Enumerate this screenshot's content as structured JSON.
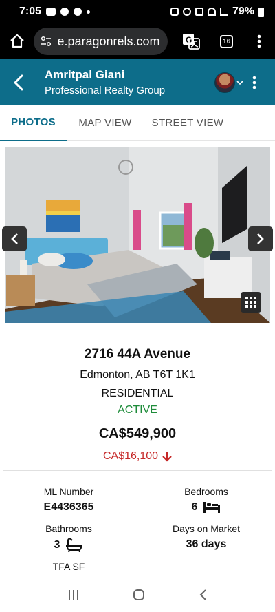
{
  "status_bar": {
    "time": "7:05",
    "battery": "79%"
  },
  "browser": {
    "url": "e.paragonrels.com",
    "tab_count": "16"
  },
  "header": {
    "agent_name": "Amritpal Giani",
    "company": "Professional Realty Group"
  },
  "tabs": [
    {
      "label": "PHOTOS",
      "active": true
    },
    {
      "label": "MAP VIEW",
      "active": false
    },
    {
      "label": "STREET VIEW",
      "active": false
    }
  ],
  "listing": {
    "address": "2716 44A Avenue",
    "city": "Edmonton, AB T6T 1K1",
    "type": "RESIDENTIAL",
    "status": "ACTIVE",
    "price": "CA$549,900",
    "price_change": "CA$16,100",
    "price_change_direction": "down"
  },
  "facts": {
    "ml_number_label": "ML Number",
    "ml_number": "E4436365",
    "bedrooms_label": "Bedrooms",
    "bedrooms": "6",
    "bathrooms_label": "Bathrooms",
    "bathrooms": "3",
    "days_label": "Days on Market",
    "days": "36 days",
    "tfa_label": "TFA SF"
  },
  "colors": {
    "brand": "#0d6d8a",
    "status_active": "#1e8c3a",
    "price_down": "#c62828"
  }
}
